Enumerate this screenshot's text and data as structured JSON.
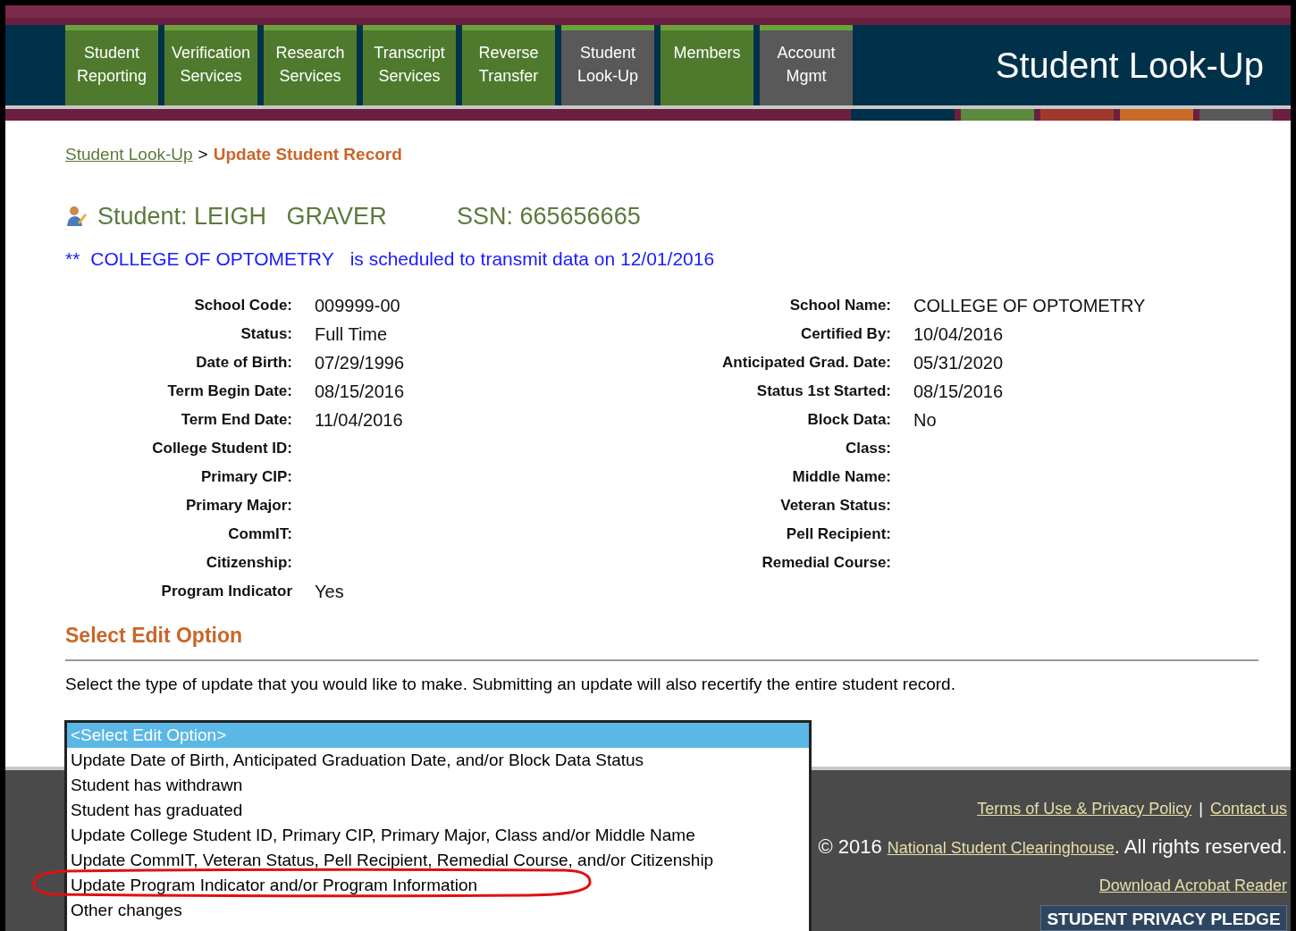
{
  "nav": {
    "tabs": [
      {
        "label": "Student Reporting",
        "color": "#4f7a2e"
      },
      {
        "label": "Verification Services",
        "color": "#4f7a2e"
      },
      {
        "label": "Research Services",
        "color": "#4f7a2e"
      },
      {
        "label": "Transcript Services",
        "color": "#4f7a2e"
      },
      {
        "label": "Reverse Transfer",
        "color": "#4f7a2e"
      },
      {
        "label": "Student Look-Up",
        "color": "#595959"
      },
      {
        "label": "Members",
        "color": "#4f7a2e"
      },
      {
        "label": "Account Mgmt",
        "color": "#595959"
      }
    ],
    "title": "Student Look-Up"
  },
  "breadcrumb": {
    "link": "Student Look-Up",
    "separator": ">",
    "current": "Update Student Record"
  },
  "student": {
    "name": "Student: LEIGH   GRAVER",
    "ssn": "SSN: 665656665"
  },
  "notice": {
    "marker": "**",
    "school": "COLLEGE OF OPTOMETRY",
    "text": "is scheduled to transmit data on 12/01/2016"
  },
  "fields_left": [
    {
      "label": "School Code:",
      "value": "009999-00"
    },
    {
      "label": "Status:",
      "value": "Full Time"
    },
    {
      "label": "Date of Birth:",
      "value": "07/29/1996"
    },
    {
      "label": "Term Begin Date:",
      "value": "08/15/2016"
    },
    {
      "label": "Term End Date:",
      "value": "11/04/2016"
    },
    {
      "label": "College Student ID:"
    },
    {
      "label": "Primary CIP:"
    },
    {
      "label": "Primary Major:"
    },
    {
      "label": "CommIT:"
    },
    {
      "label": "Citizenship:"
    },
    {
      "label": "Program Indicator",
      "value": "Yes"
    }
  ],
  "fields_right": [
    {
      "label": "School Name:",
      "value": "COLLEGE OF OPTOMETRY"
    },
    {
      "label": "Certified By:",
      "value": "10/04/2016"
    },
    {
      "label": "Anticipated Grad. Date:",
      "value": "05/31/2020"
    },
    {
      "label": "Status 1st Started:",
      "value": "08/15/2016"
    },
    {
      "label": "Block Data:",
      "value": "No"
    },
    {
      "label": "Class:"
    },
    {
      "label": "Middle Name:"
    },
    {
      "label": "Veteran Status:"
    },
    {
      "label": "Pell Recipient:"
    },
    {
      "label": "Remedial Course:"
    }
  ],
  "edit": {
    "heading": "Select Edit Option",
    "instruction": "Select the type of update that you would like to make. Submitting an update will also recertify the entire student record.",
    "options": [
      {
        "label": "<Select Edit Option>",
        "selected": true
      },
      {
        "label": "Update Date of Birth, Anticipated Graduation Date, and/or Block Data Status",
        "selected": false
      },
      {
        "label": "Student has withdrawn",
        "selected": false
      },
      {
        "label": "Student has graduated",
        "selected": false
      },
      {
        "label": "Update College Student ID, Primary CIP, Primary Major, Class and/or Middle Name",
        "selected": false
      },
      {
        "label": "Update CommIT, Veteran Status, Pell Recipient, Remedial Course, and/or Citizenship",
        "selected": false
      },
      {
        "label": "Update Program Indicator and/or Program Information",
        "selected": false
      },
      {
        "label": "Other changes",
        "selected": false
      }
    ]
  },
  "footer": {
    "terms": "Terms of Use & Privacy Policy",
    "divider": "|",
    "contact": "Contact us",
    "copyright": "© 2016",
    "org": "National Student Clearinghouse",
    "rights": ". All rights reserved.",
    "acrobat": "Download Acrobat Reader",
    "pledge": "STUDENT PRIVACY PLEDGE"
  }
}
